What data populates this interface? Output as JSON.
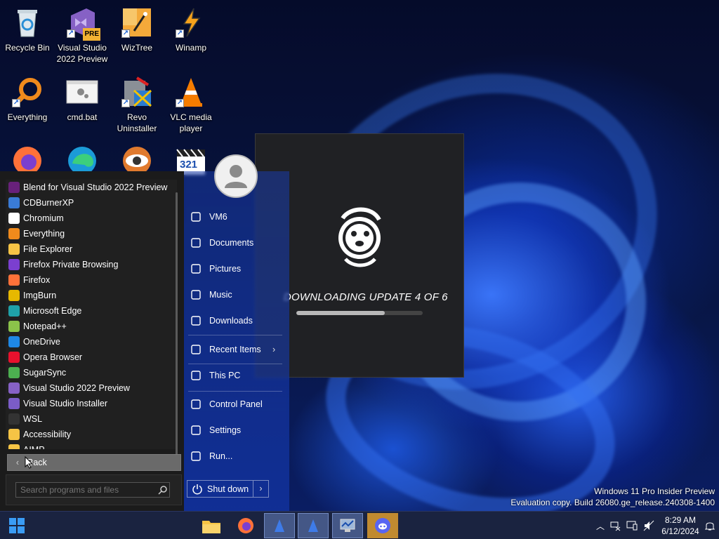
{
  "desktop": {
    "icons": [
      {
        "label": "Recycle Bin",
        "icon": "recycle-bin-icon"
      },
      {
        "label": "Visual Studio 2022 Preview",
        "icon": "visual-studio-preview-icon",
        "badge": "PRE"
      },
      {
        "label": "WizTree",
        "icon": "wiztree-icon"
      },
      {
        "label": "Winamp",
        "icon": "winamp-icon"
      },
      {
        "label": "Everything",
        "icon": "everything-icon"
      },
      {
        "label": "cmd.bat",
        "icon": "batch-file-icon"
      },
      {
        "label": "Revo Uninstaller",
        "icon": "revo-uninstaller-icon"
      },
      {
        "label": "VLC media player",
        "icon": "vlc-icon"
      },
      {
        "label": "",
        "icon": "firefox-icon"
      },
      {
        "label": "",
        "icon": "edge-icon"
      },
      {
        "label": "",
        "icon": "eye-app-icon"
      },
      {
        "label": "",
        "icon": "media-player-classic-icon",
        "badge": "321"
      }
    ]
  },
  "update": {
    "status_text": "DOWNLOADING UPDATE 4 OF 6",
    "progress": 0.7
  },
  "start_menu": {
    "programs": [
      {
        "label": "Blend for Visual Studio 2022 Preview",
        "icon": "blend-icon",
        "color": "#68217a"
      },
      {
        "label": "CDBurnerXP",
        "icon": "cdburnerxp-icon",
        "color": "#3a7bd5"
      },
      {
        "label": "Chromium",
        "icon": "chromium-icon",
        "color": "#ffffff"
      },
      {
        "label": "Everything",
        "icon": "everything-icon",
        "color": "#f08a1c"
      },
      {
        "label": "File Explorer",
        "icon": "folder-icon",
        "color": "#f6c445"
      },
      {
        "label": "Firefox Private Browsing",
        "icon": "firefox-private-icon",
        "color": "#7b3fd0"
      },
      {
        "label": "Firefox",
        "icon": "firefox-icon",
        "color": "#ff7139"
      },
      {
        "label": "ImgBurn",
        "icon": "imgburn-icon",
        "color": "#e6b800"
      },
      {
        "label": "Microsoft Edge",
        "icon": "edge-icon",
        "color": "#1fa1a8"
      },
      {
        "label": "Notepad++",
        "icon": "notepad-plus-plus-icon",
        "color": "#8bc34a"
      },
      {
        "label": "OneDrive",
        "icon": "onedrive-icon",
        "color": "#1e88e5"
      },
      {
        "label": "Opera Browser",
        "icon": "opera-icon",
        "color": "#e8112d"
      },
      {
        "label": "SugarSync",
        "icon": "sugarsync-icon",
        "color": "#4caf50"
      },
      {
        "label": "Visual Studio 2022 Preview",
        "icon": "visual-studio-icon",
        "color": "#8661c5"
      },
      {
        "label": "Visual Studio Installer",
        "icon": "visual-studio-installer-icon",
        "color": "#7b5cc7"
      },
      {
        "label": "WSL",
        "icon": "tux-icon",
        "color": "#333333"
      },
      {
        "label": "Accessibility",
        "icon": "folder-icon",
        "color": "#f6c445"
      },
      {
        "label": "AIMP",
        "icon": "folder-icon",
        "color": "#f6c445"
      }
    ],
    "back_label": "Back",
    "search_placeholder": "Search programs and files",
    "user": {
      "name": "VM6"
    },
    "right_items": [
      {
        "label": "VM6",
        "icon": "user-folder-icon"
      },
      {
        "label": "Documents",
        "icon": "document-icon"
      },
      {
        "label": "Pictures",
        "icon": "pictures-icon"
      },
      {
        "label": "Music",
        "icon": "music-icon"
      },
      {
        "label": "Downloads",
        "icon": "download-icon"
      },
      {
        "label": "Recent Items",
        "icon": "clock-icon"
      },
      {
        "label": "This PC",
        "icon": "computer-icon"
      },
      {
        "label": "Control Panel",
        "icon": "control-panel-icon"
      },
      {
        "label": "Settings",
        "icon": "gear-icon"
      },
      {
        "label": "Run...",
        "icon": "run-icon"
      }
    ],
    "shutdown_label": "Shut down"
  },
  "watermark": {
    "line1": "Windows 11 Pro Insider Preview",
    "line2": "Evaluation copy. Build 26080.ge_release.240308-1400"
  },
  "taskbar": {
    "apps": [
      "start-icon",
      "file-explorer-icon",
      "firefox-icon",
      "app-blue-1-icon",
      "app-blue-2-icon",
      "task-manager-icon",
      "discord-icon"
    ],
    "time": "8:29 AM",
    "date": "6/12/2024"
  }
}
